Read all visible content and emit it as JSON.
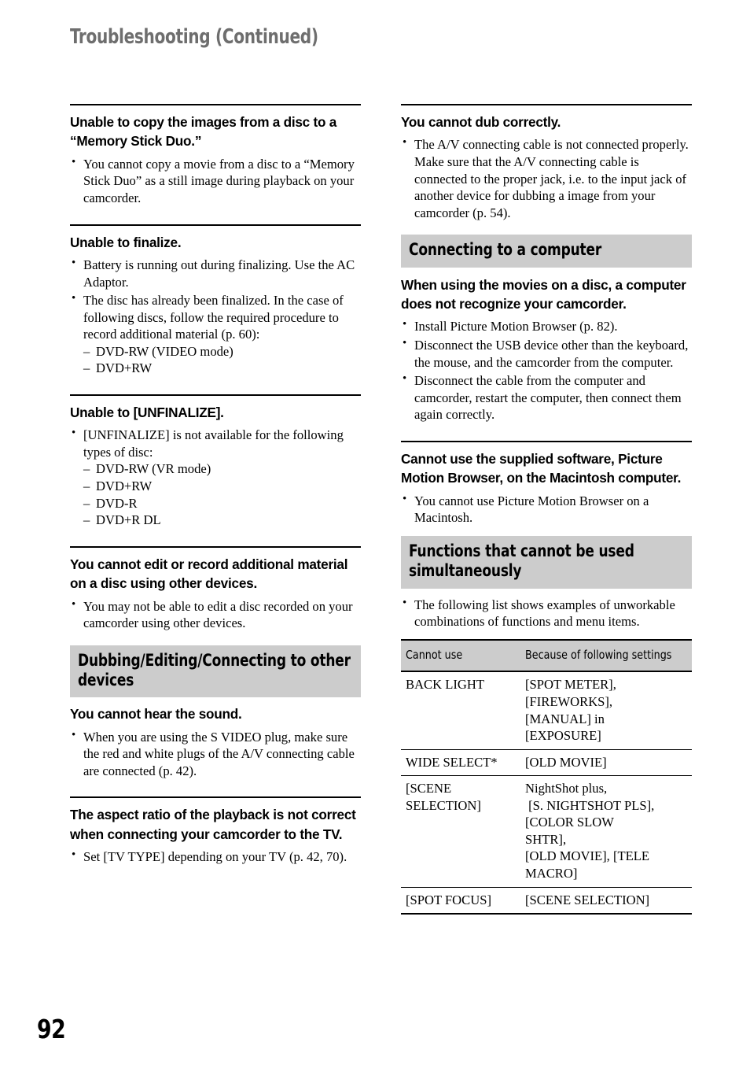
{
  "page": {
    "running_head": "Troubleshooting (Continued)",
    "folio": "92",
    "banner_bg": "#cccccc",
    "running_head_color": "#6e6e6e"
  },
  "left_column": {
    "entries": [
      {
        "heading": "Unable to copy the images from a disc to a “Memory Stick Duo.”",
        "bullets": [
          "You cannot copy a movie from a disc to a “Memory Stick Duo” as a still image during playback on your camcorder."
        ]
      },
      {
        "heading": "Unable to finalize.",
        "bullets": [
          "Battery is running out during finalizing. Use the AC Adaptor.",
          "The disc has already been finalized. In the case of following discs, follow the required procedure to record additional material (p. 60):"
        ],
        "sub_items": [
          "DVD-RW (VIDEO mode)",
          "DVD+RW"
        ]
      },
      {
        "heading": "Unable to [UNFINALIZE].",
        "bullets": [
          "[UNFINALIZE] is not available for the following types of disc:"
        ],
        "sub_items": [
          "DVD-RW (VR mode)",
          "DVD+RW",
          "DVD-R",
          "DVD+R DL"
        ]
      },
      {
        "heading": "You cannot edit or record additional material on a disc using other devices.",
        "bullets": [
          "You may not be able to edit a disc recorded on your camcorder using other devices."
        ]
      }
    ],
    "section_banner": "Dubbing/Editing/Connecting to other devices",
    "entries_after_banner": [
      {
        "heading": "You cannot hear the sound.",
        "bullets": [
          "When you are using the S VIDEO plug, make sure the red and white plugs of the A/V connecting cable are connected (p. 42)."
        ]
      },
      {
        "heading": "The aspect ratio of the playback is not correct when connecting your camcorder to the TV.",
        "bullets": [
          "Set [TV TYPE] depending on your TV (p. 42, 70)."
        ]
      }
    ]
  },
  "right_column": {
    "entry_dub": {
      "heading": "You cannot dub correctly.",
      "bullets": [
        "The A/V connecting cable is not connected properly. Make sure that the A/V connecting cable is connected to the proper jack, i.e. to the input jack of another device for dubbing a image from your camcorder (p. 54)."
      ]
    },
    "section_banner_computer": "Connecting to a computer",
    "entry_computer": {
      "heading": "When using the movies on a disc, a computer does not recognize your camcorder.",
      "bullets": [
        "Install Picture Motion Browser (p. 82).",
        "Disconnect the USB device other than the keyboard, the mouse, and the camcorder from the computer.",
        "Disconnect the cable from the computer and camcorder, restart the computer, then connect them again correctly."
      ]
    },
    "entry_macintosh": {
      "heading": "Cannot use the supplied software, Picture Motion Browser, on the Macintosh computer.",
      "bullets": [
        "You cannot use Picture Motion Browser on a Macintosh."
      ]
    },
    "section_banner_functions": "Functions that cannot be used simultaneously",
    "functions_intro_bullets": [
      "The following list shows examples of unworkable combinations of functions and menu items."
    ],
    "table": {
      "headers": [
        "Cannot use",
        "Because of following settings"
      ],
      "rows": [
        {
          "cannot_use": "BACK LIGHT",
          "because": "[SPOT METER],\n[FIREWORKS],\n[MANUAL] in\n[EXPOSURE]"
        },
        {
          "cannot_use": "WIDE SELECT*",
          "because": "[OLD MOVIE]"
        },
        {
          "cannot_use": "[SCENE SELECTION]",
          "because": "NightShot plus,\n [S. NIGHTSHOT PLS],\n[COLOR SLOW\nSHTR],\n[OLD MOVIE], [TELE\nMACRO]"
        },
        {
          "cannot_use": "[SPOT FOCUS]",
          "because": "[SCENE SELECTION]"
        }
      ]
    }
  }
}
